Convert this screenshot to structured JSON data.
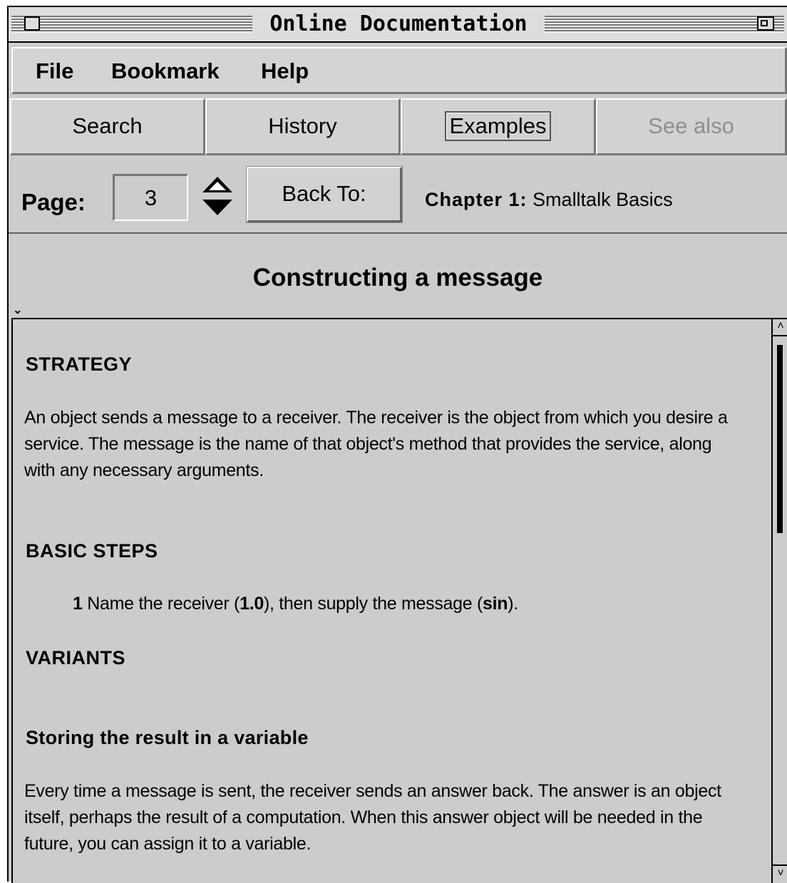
{
  "window": {
    "title": "Online Documentation"
  },
  "menu": {
    "items": [
      "File",
      "Bookmark",
      "Help"
    ]
  },
  "toolbar": {
    "search_label": "Search",
    "history_label": "History",
    "examples_label": "Examples",
    "see_also_label": "See also"
  },
  "navigation": {
    "page_label": "Page:",
    "page_value": "3",
    "back_to_label": "Back To:",
    "chapter_prefix": "Chapter 1:",
    "chapter_name": "Smalltalk Basics"
  },
  "topic": {
    "title": "Constructing a message"
  },
  "content": {
    "strategy_heading": "STRATEGY",
    "strategy_text": "An object sends a message to a receiver. The receiver is the object from which you desire a service. The message is the name of that object's method that provides the service, along with any necessary arguments.",
    "basic_steps_heading": "BASIC STEPS",
    "step": {
      "number": "1",
      "text_before": "Name the receiver (",
      "receiver_code": "1.0",
      "text_middle": "), then supply the message (",
      "message_code": "sin",
      "text_after": ")."
    },
    "variants_heading": "VARIANTS",
    "storing_heading": "Storing the result in a variable",
    "storing_text": "Every time a message is sent, the receiver sends an answer back. The answer is an object itself, perhaps the result of a computation. When this answer object will be needed in the future, you can assign it to a variable."
  },
  "colors": {
    "window_background": "#cccccc",
    "disabled_text": "#8f8f8f"
  }
}
